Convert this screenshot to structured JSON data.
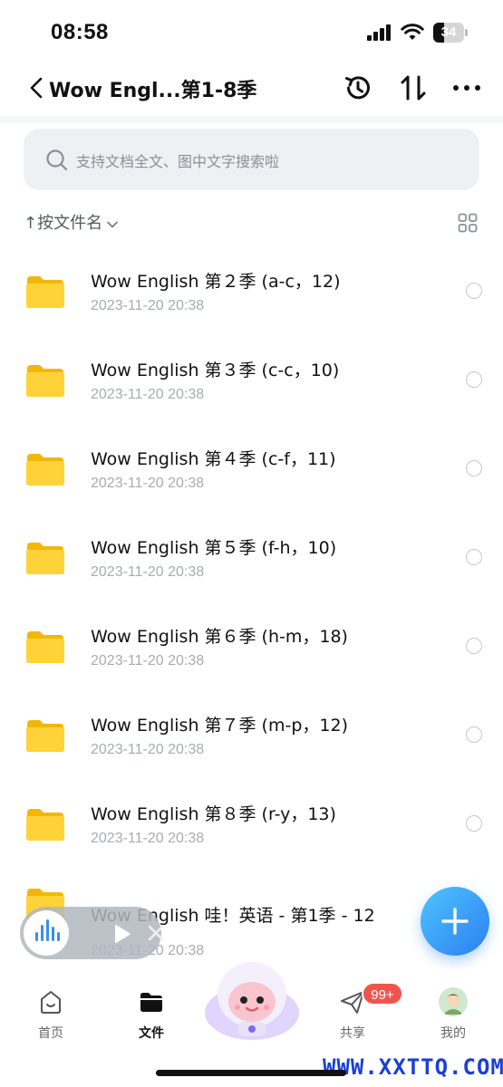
{
  "status_bar": {
    "time": "08:58",
    "battery": "34",
    "battery_level": 0.34
  },
  "header": {
    "title": "Wow Engl...第1-8季"
  },
  "search": {
    "placeholder": "支持文档全文、图中文字搜索啦"
  },
  "sort": {
    "label": "↑按文件名"
  },
  "files": [
    {
      "name": "Wow English 第２季 (a-c，12)",
      "date": "2023-11-20 20:38"
    },
    {
      "name": "Wow English 第３季 (c-c，10)",
      "date": "2023-11-20 20:38"
    },
    {
      "name": "Wow English 第４季 (c-f，11)",
      "date": "2023-11-20 20:38"
    },
    {
      "name": "Wow English 第５季 (f-h，10)",
      "date": "2023-11-20 20:38"
    },
    {
      "name": "Wow English 第６季 (h-m，18)",
      "date": "2023-11-20 20:38"
    },
    {
      "name": "Wow English 第７季 (m-p，12)",
      "date": "2023-11-20 20:38"
    },
    {
      "name": "Wow English 第８季 (r-y，13)",
      "date": "2023-11-20 20:38"
    },
    {
      "name": "Wow English 哇！英语 - 第1季 - 12",
      "date": "2023-11-20 20:38"
    }
  ],
  "nav": {
    "home": "首页",
    "files": "文件",
    "share": "共享",
    "share_badge": "99+",
    "mine": "我的"
  },
  "watermark": "WWW.XXTTQ.COM"
}
